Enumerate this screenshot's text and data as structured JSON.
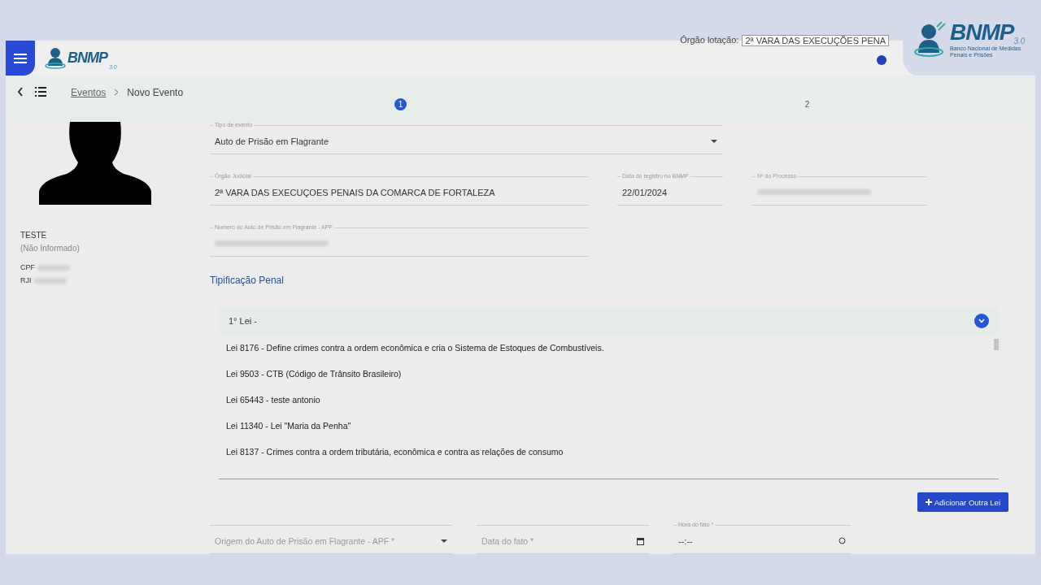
{
  "header": {
    "lotacao_label": "Órgão lotação:",
    "lotacao_value": "2ª VARA DAS EXECUÇÕES PENA",
    "logo_small": {
      "title": "BNMP",
      "version": "3.0"
    },
    "logo_big": {
      "title": "BNMP",
      "version": "3.0",
      "subtitle": "Banco Nacional de Medidas Penais e Prisões"
    }
  },
  "breadcrumb": [
    {
      "label": "Eventos",
      "link": true
    },
    {
      "label": "Novo Evento",
      "link": false
    }
  ],
  "steps": [
    {
      "label": "1",
      "selected": true
    },
    {
      "label": "2",
      "selected": false
    }
  ],
  "person": {
    "name": "TESTE",
    "note": "(Não Informado)",
    "ids": [
      {
        "label": "CPF"
      },
      {
        "label": "RJI"
      }
    ]
  },
  "fields": [
    {
      "label": "Tipo de evento",
      "value": "Auto de Prisão em Flagrante",
      "kind": "select",
      "redacted": false
    },
    {
      "label": "Órgão Judicial",
      "value": "2ª VARA DAS EXECUÇOES PENAIS DA COMARCA DE FORTALEZA",
      "kind": "text",
      "redacted": false
    },
    {
      "label": "Data do registro no BNMP",
      "value": "22/01/2024",
      "kind": "text",
      "redacted": false
    },
    {
      "label": "Nº do Processo",
      "kind": "text",
      "redacted": true
    },
    {
      "label": "Numero do Auto de Prisão em Flagrante - APF",
      "kind": "text",
      "redacted": true
    }
  ],
  "section_title": "Tipificação Penal",
  "law_panel": {
    "title": "1° Lei -",
    "expanded": true,
    "options": [
      "Lei 8176 - Define crimes contra a ordem econômica e cria o Sistema de Estoques de Combustíveis.",
      "Lei 9503 - CTB (Código de Trânsito Brasileiro)",
      "Lei 65443 - teste antonio",
      "Lei 11340 - Lei \"Maria da Penha\"",
      "Lei 8137 - Crimes contra a ordem tributária, econômica e contra as relações de consumo"
    ]
  },
  "add_button": {
    "label": "Adicionar Outra Lei"
  },
  "bottom_fields": [
    {
      "placeholder": "Origem do Auto de Prisão em Flagrante - APF *",
      "kind": "select"
    },
    {
      "placeholder": "Data do fato *",
      "kind": "date"
    },
    {
      "label": "Hora do fato *",
      "value": "--:--",
      "kind": "time"
    }
  ]
}
